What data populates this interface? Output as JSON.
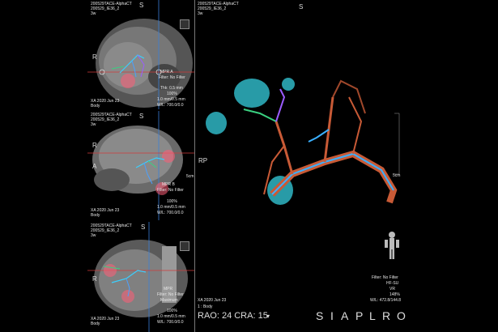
{
  "mpr_top": {
    "study": "200529TACE-AlphaCT",
    "series": "200529_IE36_2",
    "tag": "3w",
    "orient_top": "S",
    "orient_left": "R",
    "plane": "MPR A",
    "filter": "Filter: No Filter",
    "thickness": "Thk: 0.5 mm",
    "zoom": "100%",
    "spacing": "1.0 mm/0.5 mm",
    "wl": "W/L: 700.0/0.0",
    "date": "XA 2020 Jun 23",
    "body": "Body"
  },
  "mpr_mid": {
    "study": "200529TACE-AlphaCT",
    "series": "200529_IE36_2",
    "tag": "3w",
    "orient_top": "S",
    "orient_left": "R",
    "orient_bottom": "A",
    "plane": "MPR B",
    "filter": "Filter: No Filter",
    "thickness": "Thk: 0.5 mm",
    "zoom": "100%",
    "spacing": "1.0 mm/0.5 mm",
    "wl": "W/L: 700.0/0.0",
    "date": "XA 2020 Jun 23",
    "body": "Body",
    "scale": "5cm"
  },
  "mpr_bot": {
    "study": "200529TACE-AlphaCT",
    "series": "200529_IE36_2",
    "tag": "3w",
    "orient_top": "S",
    "orient_left": "R",
    "plane": "MPR",
    "filter": "Filter: No Filter",
    "thickness": "Maximum",
    "zoom": "100%",
    "spacing": "1.0 mm/0.5 mm",
    "wl": "W/L: 700.0/0.0",
    "date": "XA 2020 Jun 23",
    "body": "Body"
  },
  "vr": {
    "study": "200529TACE-AlphaCT",
    "series": "200529_IE36_2",
    "tag": "3w",
    "orient_top": "S",
    "orient_left": "RP",
    "scale": "5cm",
    "filter": "Filter: No Filter",
    "preset": "HF-SU",
    "mode": "VR",
    "zoom": "148%",
    "wl": "W/L: 472.8/144.8",
    "date": "XA 2020 Jun 23",
    "body": "1 : Body",
    "angle": "RAO: 24  CRA: 15",
    "orientation_letters": [
      "S",
      "I",
      "A",
      "P",
      "L",
      "R",
      "O"
    ]
  },
  "colors": {
    "background": "#000000",
    "tumor": "#2fb6c4",
    "vessel": "#c85a36",
    "marker": "#ff5c77",
    "crosshair_blue": "#3a7fd8",
    "crosshair_red": "#d03a3a"
  }
}
